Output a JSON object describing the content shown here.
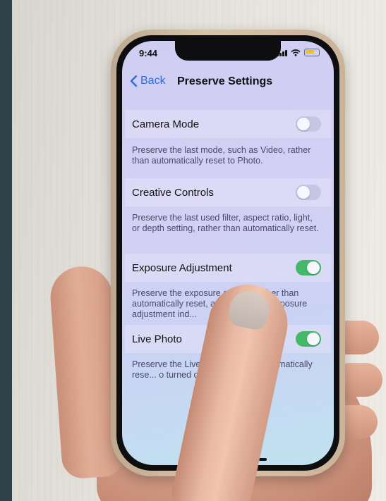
{
  "status_bar": {
    "time": "9:44"
  },
  "navbar": {
    "back_label": "Back",
    "title": "Preserve Settings"
  },
  "settings": [
    {
      "label": "Camera Mode",
      "enabled": false,
      "description": "Preserve the last mode, such as Video, rather than automatically reset to Photo."
    },
    {
      "label": "Creative Controls",
      "enabled": false,
      "description": "Preserve the last used filter, aspect ratio, light, or depth setting, rather than automatically reset."
    },
    {
      "label": "Exposure Adjustment",
      "enabled": true,
      "description": "Preserve the exposure adjustm... ther than automatically reset, and ... how the exposure adjustment ind..."
    },
    {
      "label": "Live Photo",
      "enabled": true,
      "description": "Preserve the Live Photo... r than automatically rese... o turned on."
    }
  ],
  "colors": {
    "accent": "#2f6bdc",
    "toggle_on": "#45b86a",
    "toggle_off": "#c7c4e6"
  }
}
